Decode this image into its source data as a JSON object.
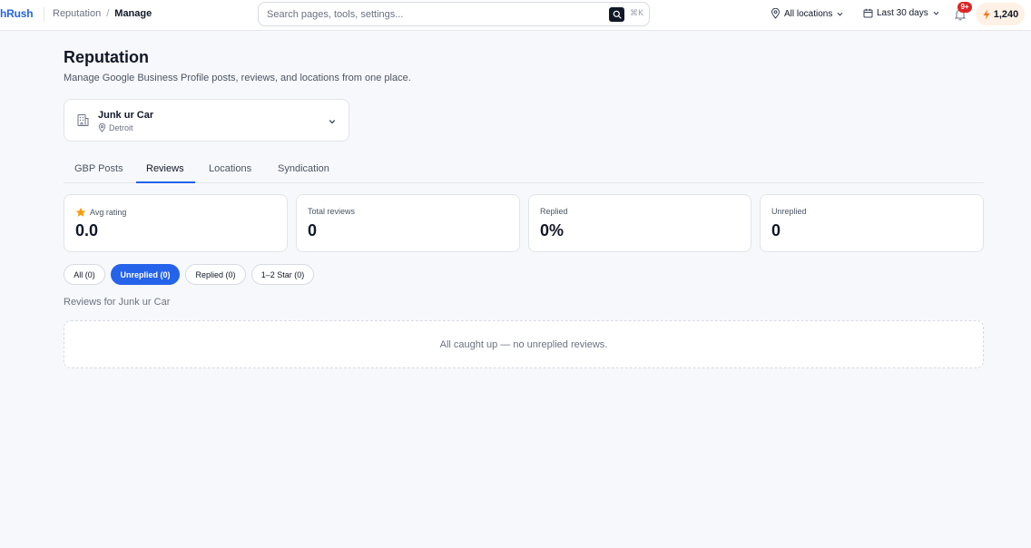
{
  "header": {
    "brand": "hRush",
    "breadcrumb": [
      "Reputation",
      "Manage"
    ],
    "search_placeholder": "Search pages, tools, settings...",
    "shortcut": "⌘K",
    "location_filter": "All locations",
    "date_filter": "Last 30 days",
    "notifications_badge": "9+",
    "credits": "1,240"
  },
  "page": {
    "title": "Reputation",
    "subtitle": "Manage Google Business Profile posts, reviews, and locations from one place."
  },
  "location": {
    "name": "Junk ur Car",
    "city": "Detroit"
  },
  "tabs": [
    {
      "label": "GBP Posts"
    },
    {
      "label": "Reviews",
      "active": true
    },
    {
      "label": "Locations"
    },
    {
      "label": "Syndication"
    }
  ],
  "stats": [
    {
      "label": "Avg rating",
      "value": "0.0",
      "icon": "star-icon"
    },
    {
      "label": "Total reviews",
      "value": "0"
    },
    {
      "label": "Replied",
      "value": "0%"
    },
    {
      "label": "Unreplied",
      "value": "0"
    }
  ],
  "filters": [
    {
      "label": "All (0)"
    },
    {
      "label": "Unreplied (0)",
      "active": true
    },
    {
      "label": "Replied (0)"
    },
    {
      "label": "1–2 Star (0)"
    }
  ],
  "reviews_label": "Reviews for Junk ur Car",
  "empty_state": "All caught up — no unreplied reviews.",
  "colors": {
    "accent": "#2563eb",
    "badge": "#dc2626",
    "star": "#f59e0b",
    "credits_bg": "#fff1e6"
  }
}
